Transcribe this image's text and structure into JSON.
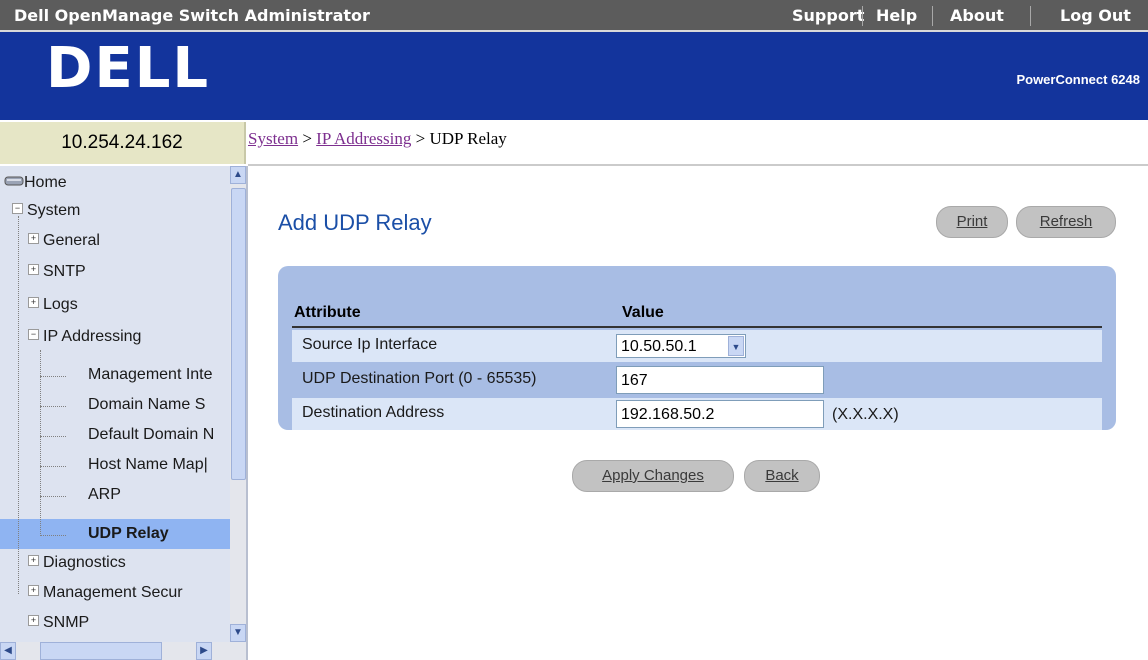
{
  "app": {
    "title": "Dell OpenManage Switch Administrator",
    "links": [
      "Support",
      "Help",
      "About",
      "Log Out"
    ]
  },
  "header": {
    "logo_text": "DELL",
    "model": "PowerConnect 6248"
  },
  "device": {
    "ip": "10.254.24.162"
  },
  "breadcrumb": {
    "system": "System",
    "sep1": " > ",
    "ip_addressing": "IP Addressing",
    "sep2": " > ",
    "current": "UDP Relay"
  },
  "nav": {
    "items": {
      "home": "Home",
      "system": "System",
      "general": "General",
      "sntp": "SNTP",
      "logs": "Logs",
      "ip_addressing": "IP Addressing",
      "management_interface": "Management Inte",
      "domain_name_server": "Domain Name S",
      "default_domain": "Default Domain N",
      "host_name_mapping": "Host Name Map|",
      "arp": "ARP",
      "udp_relay": "UDP Relay",
      "diagnostics": "Diagnostics",
      "management_security": "Management Secur",
      "snmp": "SNMP"
    },
    "selected": "UDP Relay"
  },
  "main": {
    "title": "Add UDP Relay",
    "print_label": "Print",
    "refresh_label": "Refresh",
    "table": {
      "col_attribute": "Attribute",
      "col_value": "Value",
      "rows": [
        {
          "label": "Source Ip Interface",
          "value": "10.50.50.1"
        },
        {
          "label": "UDP Destination Port (0 - 65535)",
          "value": "167"
        },
        {
          "label": "Destination Address",
          "value": "192.168.50.2",
          "hint": "(X.X.X.X)"
        }
      ]
    },
    "apply_label": "Apply Changes",
    "back_label": "Back"
  },
  "colors": {
    "topbar": "#5c5c5c",
    "header": "#13349c",
    "nav_bg": "#dde3f0",
    "nav_selected": "#8fb4f2",
    "title_blue": "#1b4fa7",
    "panel": "#a8bde4",
    "row_light": "#dbe6f7",
    "link_purple": "#7d2f8f"
  }
}
